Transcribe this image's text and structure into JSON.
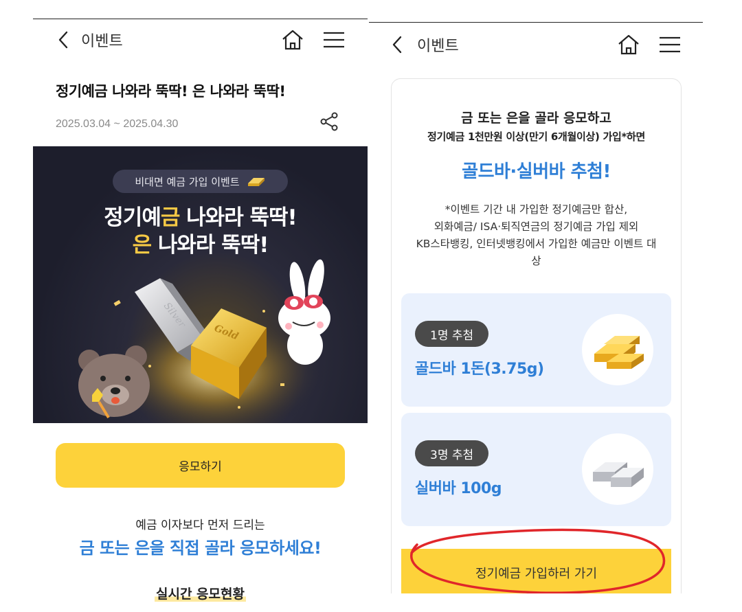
{
  "left": {
    "header": {
      "title": "이벤트"
    },
    "event_title": "정기예금 나와라 뚝딱! 은 나와라 뚝딱!",
    "event_date": "2025.03.04 ~ 2025.04.30",
    "banner": {
      "pill": "비대면 예금 가입 이벤트",
      "line1_a": "정기예",
      "line1_b": "금",
      "line1_c": " 나와라 뚝딱!",
      "line2_a": "은",
      "line2_b": " 나와라 뚝딱!",
      "silver_label": "Silver",
      "gold_label": "Gold"
    },
    "apply_label": "응모하기",
    "sub1": "예금 이자보다 먼저 드리는",
    "sub2": "금 또는 은을 직접 골라 응모하세요!",
    "realtime": "실시간 응모현황"
  },
  "right": {
    "header": {
      "title": "이벤트"
    },
    "card": {
      "line1": "금 또는 은을 골라 응모하고",
      "line2": "정기예금 1천만원 이상(만기 6개월이상) 가입*하면",
      "line3": "골드바·실버바 추첨!",
      "notes": [
        "*이벤트 기간 내 가입한 정기예금만 합산,",
        "외화예금/ ISA·퇴직연금의 정기예금 가입 제외",
        "KB스타뱅킹, 인터넷뱅킹에서 가입한 예금만 이벤트 대",
        "상"
      ],
      "prizes": [
        {
          "tag": "1명 추첨",
          "name": "골드바 1돈(3.75g)"
        },
        {
          "tag": "3명 추첨",
          "name": "실버바 100g"
        }
      ],
      "go_label": "정기예금 가입하러 가기"
    }
  },
  "colors": {
    "accent_yellow": "#fdd23a",
    "accent_blue": "#2f7fd6",
    "banner_bg": "#1d1e2c",
    "annotation_red": "#e0262a"
  }
}
